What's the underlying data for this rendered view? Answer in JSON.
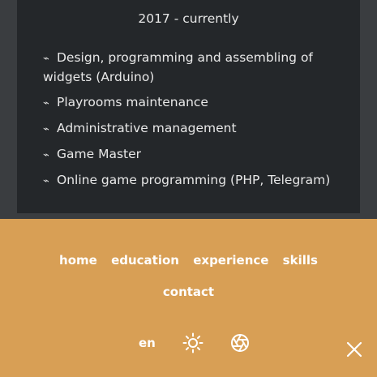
{
  "experience": {
    "period": "2017 - currently",
    "duties": [
      "Design, programming and assembling of widgets (Arduino)",
      "Playrooms maintenance",
      "Administrative management",
      "Game Master",
      "Online game programming (PHP, Telegram)"
    ],
    "bullet": "⌁"
  },
  "menu": {
    "links": [
      "home",
      "education",
      "experience",
      "skills",
      "contact"
    ],
    "language": "en",
    "theme_icon": "sun-icon",
    "aperture_icon": "aperture-icon",
    "close_icon": "close-icon"
  },
  "colors": {
    "page_background": "#3a3d40",
    "card_background": "#24272a",
    "menu_background": "#d89f55",
    "menu_text": "#ffffff"
  }
}
